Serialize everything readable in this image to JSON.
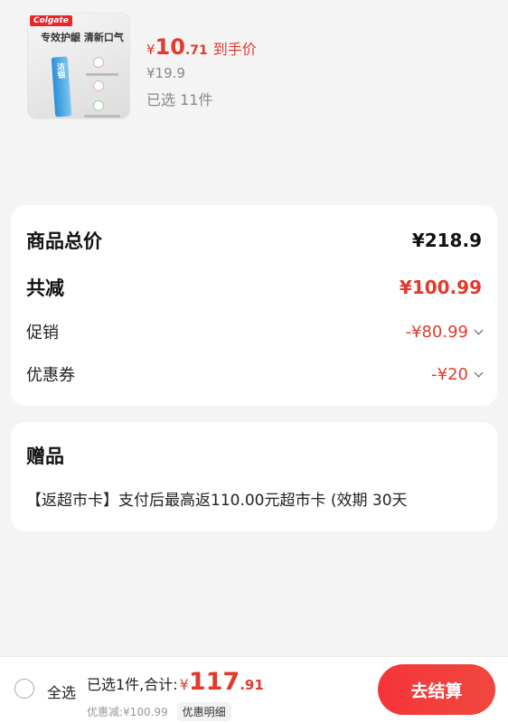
{
  "product": {
    "image_brand": "Colgate",
    "image_slogan": "专效护龈 清新口气",
    "image_tube_text": "洁银",
    "price_currency": "¥",
    "price_integer": "10",
    "price_decimal": ".71",
    "price_tag": "到手价",
    "original_price": "¥19.9",
    "selected_count": "已选 11件"
  },
  "summary": {
    "total_label": "商品总价",
    "total_value": "¥218.9",
    "reduce_label": "共减",
    "reduce_value": "¥100.99",
    "promo_label": "促销",
    "promo_value": "-¥80.99",
    "coupon_label": "优惠券",
    "coupon_value": "-¥20"
  },
  "gift": {
    "title": "赠品",
    "description": "【返超市卡】支付后最高返110.00元超市卡 (效期 30天"
  },
  "bottom_bar": {
    "select_all_label": "全选",
    "summary_label": "已选1件,合计:",
    "currency": "¥",
    "total_integer": "117",
    "total_decimal": ".91",
    "discount_text": "优惠减:¥100.99",
    "discount_detail_label": "优惠明细",
    "checkout_label": "去结算"
  },
  "colors": {
    "accent_red": "#e23a2c",
    "checkout_button": "#f5343a",
    "background": "#f4f4f4"
  }
}
